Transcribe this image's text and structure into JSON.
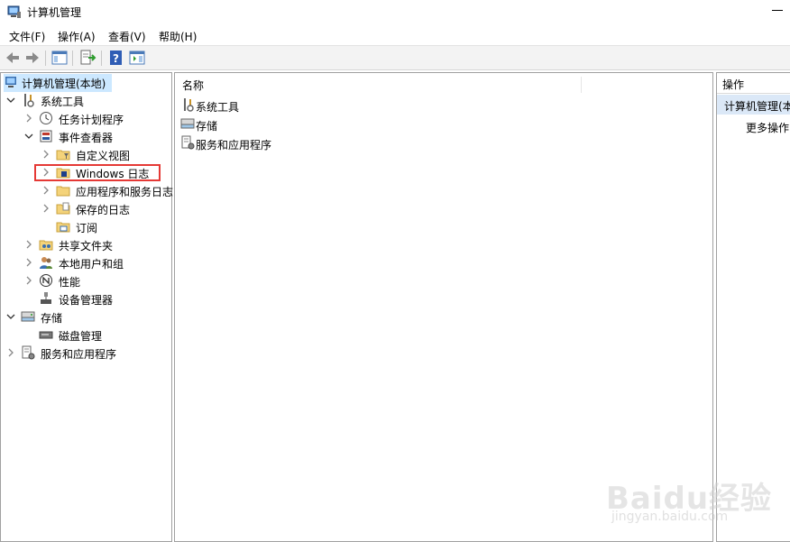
{
  "window": {
    "title": "计算机管理"
  },
  "menubar": {
    "items": [
      "文件(F)",
      "操作(A)",
      "查看(V)",
      "帮助(H)"
    ]
  },
  "tree": {
    "root": "计算机管理(本地)",
    "system_tools": "系统工具",
    "task_scheduler": "任务计划程序",
    "event_viewer": "事件查看器",
    "custom_views": "自定义视图",
    "windows_logs": "Windows 日志",
    "app_service_logs": "应用程序和服务日志",
    "saved_logs": "保存的日志",
    "subscriptions": "订阅",
    "shared_folders": "共享文件夹",
    "local_users_groups": "本地用户和组",
    "performance": "性能",
    "device_manager": "设备管理器",
    "storage": "存储",
    "disk_management": "磁盘管理",
    "services_apps": "服务和应用程序"
  },
  "list": {
    "header_name": "名称",
    "items": [
      "系统工具",
      "存储",
      "服务和应用程序"
    ]
  },
  "actions": {
    "header": "操作",
    "selected": "计算机管理(本",
    "more": "更多操作"
  },
  "watermark": {
    "main": "Baidu经验",
    "sub": "jingyan.baidu.com"
  },
  "colors": {
    "selection": "#cce8ff",
    "highlight_box": "#e53935",
    "toolbar_bg": "#f3f3f3"
  }
}
